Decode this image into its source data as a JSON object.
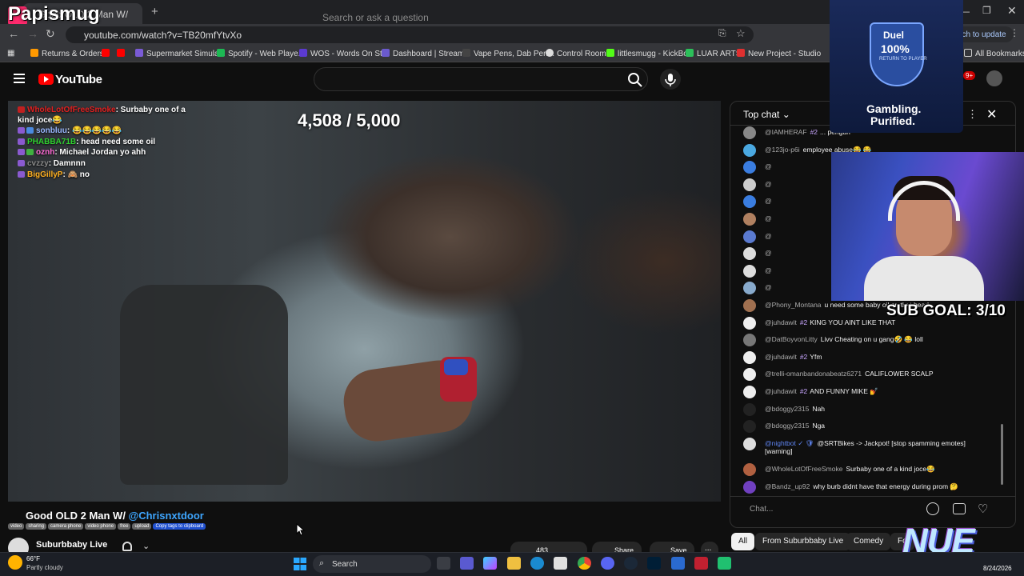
{
  "browser": {
    "tab_title": "Good OLD 2 Man W/",
    "url": "youtube.com/watch?v=TB20mfYtvXo",
    "update_button": "nch to update",
    "bookmarks": [
      {
        "label": "Returns & Orders",
        "color": "#ff9900"
      },
      {
        "label": "Supermarket Simula...",
        "color": "#7a5bd6"
      },
      {
        "label": "Spotify - Web Playe...",
        "color": "#1db954"
      },
      {
        "label": "WOS - Words On St...",
        "color": "#5b3ad0"
      },
      {
        "label": "Dashboard | Stream...",
        "color": "#6a5acd"
      },
      {
        "label": "Vape Pens, Dab Pen...",
        "color": "#444444"
      },
      {
        "label": "Control Room",
        "color": "#dddddd"
      },
      {
        "label": "littlesmugg - KickBot",
        "color": "#53fc18"
      },
      {
        "label": "LUAR ARTS",
        "color": "#2cbf5a"
      },
      {
        "label": "New Project - Studio",
        "color": "#e03030"
      }
    ],
    "all_bookmarks": "All Bookmarks"
  },
  "youtube": {
    "logo_text": "YouTube",
    "search_placeholder": "Search or ask a question",
    "notification_count": "9+"
  },
  "overlay": {
    "streamer_name": "Papismug",
    "goal_counter": "4,508 / 5,000",
    "sub_goal": "SUB GOAL: 3/10",
    "stream_chat": [
      {
        "user": "WholeLotOfFreeSmoke",
        "text": ": Surbaby one of a",
        "user_color": "#e02020"
      },
      {
        "user": "",
        "text": "kind joce😂",
        "user_color": "#ffffff"
      },
      {
        "user": "sonbluu",
        "text": ": 😂😂😂😂😂",
        "user_color": "#9ab8ff"
      },
      {
        "user": "PHABBA71B",
        "text": ": head need some oil",
        "user_color": "#30d030"
      },
      {
        "user": "oznh",
        "text": ": Michael Jordan yo ahh",
        "user_color": "#ff6ad5"
      },
      {
        "user": "cvzzy",
        "text": ": Damnnn",
        "user_color": "#888888"
      },
      {
        "user": "BigGillyP",
        "text": ": 🙈 no",
        "user_color": "#ffb020"
      }
    ],
    "ad": {
      "title": "Duel",
      "percent": "100%",
      "subtitle": "RETURN TO PLAYER",
      "tagline_1": "Gambling.",
      "tagline_2": "Purified."
    },
    "nue_logo": "NUE"
  },
  "video": {
    "title_prefix": "Good OLD 2 Man W/ ",
    "title_mention": "@Chrisnxtdoor",
    "tags": [
      "video",
      "sharing",
      "camera phone",
      "video phone",
      "free",
      "upload"
    ],
    "copy_tags": "Copy tags to clipboard",
    "channel_name": "Suburbbaby Live",
    "like_count": "483",
    "share_label": "Share",
    "save_label": "Save",
    "more_label": "..."
  },
  "chat": {
    "header": "Top chat",
    "input_placeholder": "Chat...",
    "messages": [
      {
        "author": "@IAMHERAF",
        "member": "#2",
        "text": "... pengun",
        "mod": false,
        "avatar_color": "#888888"
      },
      {
        "author": "@123jo-p6i",
        "member": "",
        "text": "employee abuse😂 😂",
        "mod": false,
        "avatar_color": "#4aa8e0"
      },
      {
        "author": "@",
        "member": "",
        "text": "",
        "mod": false,
        "avatar_color": "#3a7de0"
      },
      {
        "author": "@",
        "member": "",
        "text": "",
        "mod": false,
        "avatar_color": "#cccccc"
      },
      {
        "author": "@",
        "member": "",
        "text": "",
        "mod": false,
        "avatar_color": "#3a7de0"
      },
      {
        "author": "@",
        "member": "",
        "text": "",
        "mod": false,
        "avatar_color": "#b08060"
      },
      {
        "author": "@",
        "member": "",
        "text": "",
        "mod": false,
        "avatar_color": "#5a7ad0"
      },
      {
        "author": "@",
        "member": "",
        "text": "",
        "mod": false,
        "avatar_color": "#dddddd"
      },
      {
        "author": "@",
        "member": "",
        "text": "",
        "mod": false,
        "avatar_color": "#dddddd"
      },
      {
        "author": "@",
        "member": "",
        "text": "",
        "mod": false,
        "avatar_color": "#88aacc"
      },
      {
        "author": "@Phony_Montana",
        "member": "",
        "text": "u need some baby oil on that head",
        "mod": false,
        "avatar_color": "#a07050"
      },
      {
        "author": "@juhdawit",
        "member": "#2",
        "text": "KING YOU AINT LIKE THAT",
        "mod": false,
        "avatar_color": "#eeeeee"
      },
      {
        "author": "@DatBoyvonLitty",
        "member": "",
        "text": "Livv Cheating on u gang🤣 😂 loll",
        "mod": false,
        "avatar_color": "#777777"
      },
      {
        "author": "@juhdawit",
        "member": "#2",
        "text": "Yfm",
        "mod": false,
        "avatar_color": "#eeeeee"
      },
      {
        "author": "@trelli-omanbandonabeatz6271",
        "member": "",
        "text": "CALIFLOWER SCALP",
        "mod": false,
        "avatar_color": "#eeeeee"
      },
      {
        "author": "@juhdawit",
        "member": "#2",
        "text": "AND FUNNY MIKE 💅",
        "mod": false,
        "avatar_color": "#eeeeee"
      },
      {
        "author": "@bdoggy2315",
        "member": "",
        "text": "Nah",
        "mod": false,
        "avatar_color": "#222222"
      },
      {
        "author": "@bdoggy2315",
        "member": "",
        "text": "Nga",
        "mod": false,
        "avatar_color": "#222222"
      },
      {
        "author": "@nightbot ✓ 🛡",
        "member": "",
        "text": "@SRTBikes -> Jackpot! [stop spamming emotes]",
        "mod": true,
        "avatar_color": "#dddddd"
      },
      {
        "author": "",
        "member": "",
        "text": "[warning]",
        "mod": false,
        "avatar_color": ""
      },
      {
        "author": "@WholeLotOfFreeSmoke",
        "member": "",
        "text": "Surbaby one of a kind joce😂",
        "mod": false,
        "avatar_color": "#b06040"
      },
      {
        "author": "@Bandz_up92",
        "member": "",
        "text": "why burb didnt have that energy during prom 🤔",
        "mod": false,
        "avatar_color": "#7040c0"
      }
    ]
  },
  "chips": [
    {
      "label": "All",
      "active": true
    },
    {
      "label": "From Suburbbaby Live",
      "active": false
    },
    {
      "label": "Comedy",
      "active": false
    },
    {
      "label": "Fo",
      "active": false
    }
  ],
  "taskbar": {
    "weather_temp": "66°F",
    "weather_desc": "Partly cloudy",
    "search_label": "Search",
    "date": "8/24/2026"
  }
}
